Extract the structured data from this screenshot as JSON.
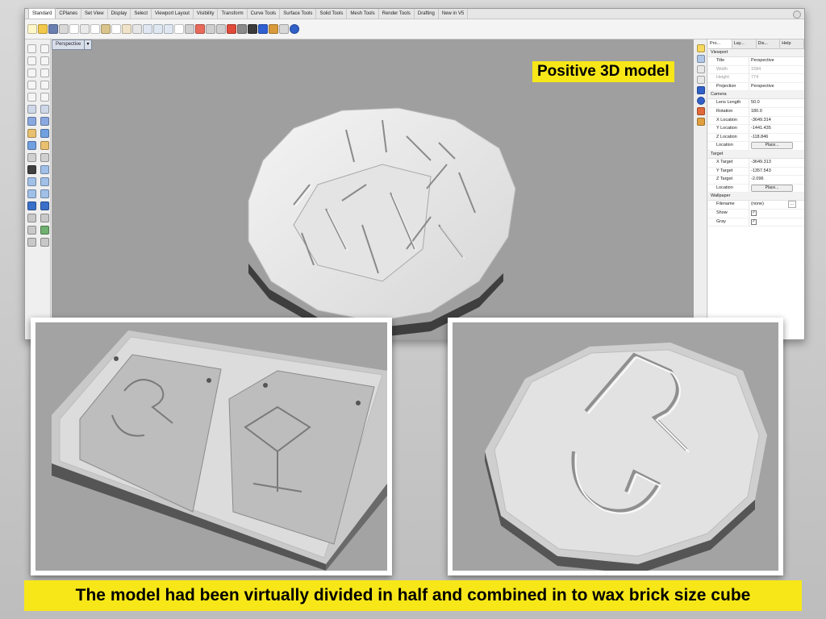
{
  "tabs": [
    "Standard",
    "CPlanes",
    "Set View",
    "Display",
    "Select",
    "Viewport Layout",
    "Visibility",
    "Transform",
    "Curve Tools",
    "Surface Tools",
    "Solid Tools",
    "Mesh Tools",
    "Render Tools",
    "Drafting",
    "New in V5"
  ],
  "active_tab": "Standard",
  "viewport": {
    "name": "Perspective",
    "overlay_label": "Positive 3D model"
  },
  "panel": {
    "tabs": [
      "Pro...",
      "Lay...",
      "Dis...",
      "Help"
    ],
    "viewport_section": "Viewport",
    "title_key": "Title",
    "title_val": "Perspective",
    "width_key": "Width",
    "width_val": "1584",
    "height_key": "Height",
    "height_val": "774",
    "projection_key": "Projection",
    "projection_val": "Perspective",
    "camera_section": "Camera",
    "lens_key": "Lens Length",
    "lens_val": "50.0",
    "rotation_key": "Rotation",
    "rotation_val": "180.0",
    "xloc_key": "X Location",
    "xloc_val": "-3649.314",
    "yloc_key": "Y Location",
    "yloc_val": "-1441.435",
    "zloc_key": "Z Location",
    "zloc_val": "-118.846",
    "location_key": "Location",
    "place_label": "Place...",
    "target_section": "Target",
    "xt_key": "X Target",
    "xt_val": "-3649.313",
    "yt_key": "Y Target",
    "yt_val": "-1357.543",
    "zt_key": "Z Target",
    "zt_val": "-2.096",
    "tlocation_key": "Location",
    "wallpaper_section": "Wallpaper",
    "filename_key": "Filename",
    "filename_val": "(none)",
    "show_key": "Show",
    "gray_key": "Gray"
  },
  "caption": "The model had been virtually divided in half and combined in to wax brick size cube",
  "colors": {
    "caption_bg": "#f7e718",
    "viewport_bg": "#9f9f9f"
  },
  "icons": [
    "new-icon",
    "open-icon",
    "save-icon",
    "print-icon",
    "properties-icon",
    "cut-icon",
    "copy-icon",
    "paste-icon",
    "undo-icon",
    "pan-icon",
    "rotate-icon",
    "zoom-icon",
    "zoom-window-icon",
    "zoom-extents-icon",
    "select-icon",
    "grid-icon",
    "cplane-icon",
    "shade-icon",
    "render-icon",
    "light-icon",
    "material-icon",
    "help-icon"
  ]
}
